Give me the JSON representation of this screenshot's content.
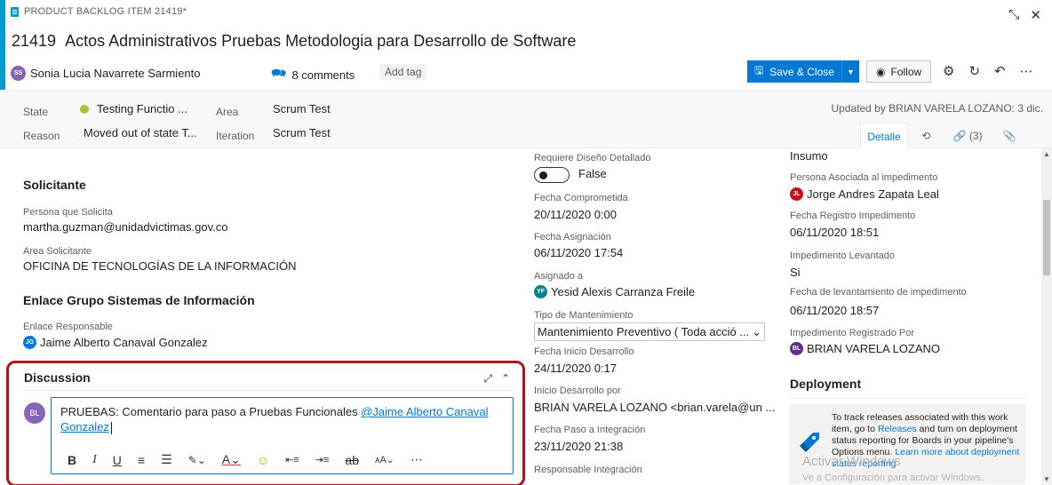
{
  "header": {
    "item_type": "PRODUCT BACKLOG ITEM 21419*",
    "id": "21419",
    "title": "Actos Administrativos Pruebas Metodologia para Desarrollo de Software",
    "assigned_initials": "SS",
    "assigned_name": "Sonia Lucia Navarrete Sarmiento",
    "comments": "8 comments",
    "add_tag": "Add tag",
    "save_close": "Save & Close",
    "follow": "Follow"
  },
  "state_panel": {
    "state_label": "State",
    "state_value": "Testing Functio ...",
    "reason_label": "Reason",
    "reason_value": "Moved out of state T...",
    "area_label": "Area",
    "area_value": "Scrum Test",
    "iteration_label": "Iteration",
    "iteration_value": "Scrum Test",
    "updated_by": "Updated by BRIAN VARELA LOZANO: 3 dic.",
    "tab_detail": "Detalle",
    "tab_links": "(3)"
  },
  "left_col": {
    "solicitante_title": "Solicitante",
    "persona_label": "Persona que Solicita",
    "persona_value": "martha.guzman@unidadvictimas.gov.co",
    "area_label": "Area Solicitante",
    "area_value": "OFICINA DE TECNOLOGÍAS DE LA INFORMACIÓN",
    "enlace_title": "Enlace Grupo Sistemas de Información",
    "enlace_label": "Enlace Responsable",
    "enlace_initials": "JG",
    "enlace_name": "Jaime Alberto Canaval Gonzalez"
  },
  "discussion": {
    "title": "Discussion",
    "avatar": "BL",
    "comment_text": "PRUEBAS: Comentario para paso a Pruebas Funcionales ",
    "mention": "@Jaime Alberto Canaval Gonzalez"
  },
  "mid_col": {
    "diseno_label": "Requiere Diseño Detallado",
    "diseno_value": "False",
    "comprometida_label": "Fecha Comprometida",
    "comprometida_value": "20/11/2020 0:00",
    "asignacion_label": "Fecha Asignación",
    "asignacion_value": "06/11/2020 17:54",
    "asignado_label": "Asignado a",
    "asignado_initials": "YF",
    "asignado_name": "Yesid Alexis Carranza Freile",
    "mantenimiento_label": "Tipo de Mantenimiento",
    "mantenimiento_value": "Mantenimiento Preventivo ( Toda acció ...",
    "inicio_label": "Fecha Inicio Desarrollo",
    "inicio_value": "24/11/2020 0:17",
    "inicio_por_label": "Inicio Desarrollo por",
    "inicio_por_value": "BRIAN VARELA LOZANO <brian.varela@un ...",
    "paso_label": "Fecha Paso a Integración",
    "paso_value": "23/11/2020 21:38",
    "responsable_label": "Responsable Integración"
  },
  "right_col": {
    "insumo": "Insumo",
    "persona_imp_label": "Persona Asociada al impedimento",
    "persona_imp_initials": "JL",
    "persona_imp_name": "Jorge Andres Zapata Leal",
    "registro_label": "Fecha Registro Impedimento",
    "registro_value": "06/11/2020 18:51",
    "levantado_label": "Impedimento Levantado",
    "levantado_value": "Si",
    "fecha_lev_label": "Fecha de levantamiento de impedimento",
    "fecha_lev_value": "06/11/2020 18:57",
    "registrado_label": "Impedimento Registrado Por",
    "registrado_initials": "BL",
    "registrado_name": "BRIAN VARELA LOZANO",
    "deployment_title": "Deployment",
    "deploy_text_1": "To track releases associated with this work item, go to ",
    "deploy_link_1": "Releases",
    "deploy_text_2": " and turn on deployment status reporting for Boards in your pipeline's Options menu. ",
    "deploy_link_2": "Learn more about deployment status reporting",
    "watermark_1": "Activar Windows",
    "watermark_2": "Ve a Configuración para activar Windows."
  },
  "colors": {
    "accent": "#0078d4",
    "state_green": "#a6c933",
    "highlight_red": "#b0121f"
  }
}
